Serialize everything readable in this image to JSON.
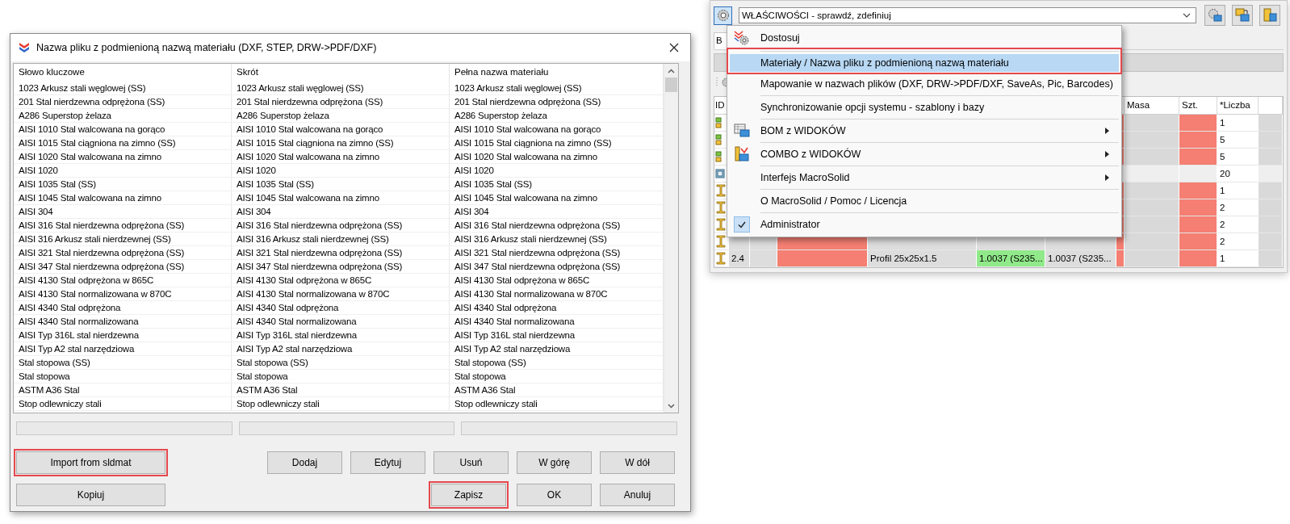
{
  "dialog": {
    "title": "Nazwa pliku z podmienioną nazwą materiału (DXF, STEP, DRW->PDF/DXF)",
    "table": {
      "columns": [
        "Słowo kluczowe",
        "Skrót",
        "Pełna nazwa materiału"
      ],
      "rows": [
        [
          "1023 Arkusz stali węglowej (SS)",
          "1023 Arkusz stali węglowej (SS)",
          "1023 Arkusz stali węglowej (SS)"
        ],
        [
          "201 Stal nierdzewna odprężona (SS)",
          "201 Stal nierdzewna odprężona (SS)",
          "201 Stal nierdzewna odprężona (SS)"
        ],
        [
          "A286 Superstop żelaza",
          "A286 Superstop żelaza",
          "A286 Superstop żelaza"
        ],
        [
          "AISI 1010 Stal walcowana na gorąco",
          "AISI 1010 Stal walcowana na gorąco",
          "AISI 1010 Stal walcowana na gorąco"
        ],
        [
          "AISI 1015 Stal ciągniona na zimno (SS)",
          "AISI 1015 Stal ciągniona na zimno (SS)",
          "AISI 1015 Stal ciągniona na zimno (SS)"
        ],
        [
          "AISI 1020 Stal walcowana na zimno",
          "AISI 1020 Stal walcowana na zimno",
          "AISI 1020 Stal walcowana na zimno"
        ],
        [
          "AISI 1020",
          "AISI 1020",
          "AISI 1020"
        ],
        [
          "AISI 1035 Stal (SS)",
          "AISI 1035 Stal (SS)",
          "AISI 1035 Stal (SS)"
        ],
        [
          "AISI 1045 Stal walcowana na zimno",
          "AISI 1045 Stal walcowana na zimno",
          "AISI 1045 Stal walcowana na zimno"
        ],
        [
          "AISI 304",
          "AISI 304",
          "AISI 304"
        ],
        [
          "AISI 316 Stal nierdzewna odprężona (SS)",
          "AISI 316 Stal nierdzewna odprężona (SS)",
          "AISI 316 Stal nierdzewna odprężona (SS)"
        ],
        [
          "AISI 316 Arkusz stali nierdzewnej (SS)",
          "AISI 316 Arkusz stali nierdzewnej (SS)",
          "AISI 316 Arkusz stali nierdzewnej (SS)"
        ],
        [
          "AISI 321 Stal nierdzewna odprężona (SS)",
          "AISI 321 Stal nierdzewna odprężona (SS)",
          "AISI 321 Stal nierdzewna odprężona (SS)"
        ],
        [
          "AISI 347 Stal nierdzewna odprężona (SS)",
          "AISI 347 Stal nierdzewna odprężona (SS)",
          "AISI 347 Stal nierdzewna odprężona (SS)"
        ],
        [
          "AISI 4130 Stal odprężona w 865C",
          "AISI 4130 Stal odprężona w 865C",
          "AISI 4130 Stal odprężona w 865C"
        ],
        [
          "AISI 4130 Stal normalizowana w 870C",
          "AISI 4130 Stal normalizowana w 870C",
          "AISI 4130 Stal normalizowana w 870C"
        ],
        [
          "AISI 4340 Stal odprężona",
          "AISI 4340 Stal odprężona",
          "AISI 4340 Stal odprężona"
        ],
        [
          "AISI 4340 Stal normalizowana",
          "AISI 4340 Stal normalizowana",
          "AISI 4340 Stal normalizowana"
        ],
        [
          "AISI Typ 316L stal nierdzewna",
          "AISI Typ 316L stal nierdzewna",
          "AISI Typ 316L stal nierdzewna"
        ],
        [
          "AISI Typ A2 stal narzędziowa",
          "AISI Typ A2 stal narzędziowa",
          "AISI Typ A2 stal narzędziowa"
        ],
        [
          "Stal stopowa (SS)",
          "Stal stopowa (SS)",
          "Stal stopowa (SS)"
        ],
        [
          "Stal stopowa",
          "Stal stopowa",
          "Stal stopowa"
        ],
        [
          "ASTM A36 Stal",
          "ASTM A36 Stal",
          "ASTM A36 Stal"
        ],
        [
          "Stop odlewniczy stali",
          "Stop odlewniczy stali",
          "Stop odlewniczy stali"
        ]
      ]
    },
    "fields": [
      {
        "disabled": true
      },
      {
        "disabled": true
      },
      {
        "disabled": true
      }
    ],
    "button_rows": [
      {
        "left": [
          {
            "label": "Import from sldmat",
            "highlighted": true
          }
        ],
        "right": [
          {
            "label": "Dodaj",
            "highlighted": false
          },
          {
            "label": "Edytuj",
            "highlighted": false
          },
          {
            "label": "Usuń",
            "highlighted": false
          },
          {
            "label": "W górę",
            "highlighted": false
          },
          {
            "label": "W dół",
            "highlighted": false
          }
        ]
      },
      {
        "left": [
          {
            "label": "Kopiuj",
            "highlighted": false
          }
        ],
        "right": [
          {
            "label": "Zapisz",
            "highlighted": true
          },
          {
            "label": "OK",
            "highlighted": false
          },
          {
            "label": "Anuluj",
            "highlighted": false
          }
        ]
      }
    ]
  },
  "panel": {
    "menu_button": {
      "open": true
    },
    "dropdown": {
      "value": "WŁAŚCIWOŚCI - sprawdź, zdefiniuj"
    },
    "tabs": [
      {
        "label": "B",
        "selected": true
      }
    ],
    "bom_table": {
      "header": {
        "id": "ID",
        "mass": "Masa",
        "qty": "Szt.",
        "count": "*Liczba"
      },
      "rows": [
        {
          "kind": "part",
          "count": "1"
        },
        {
          "kind": "part",
          "count": "5"
        },
        {
          "kind": "part",
          "count": "5"
        },
        {
          "kind": "group",
          "count": "20"
        },
        {
          "kind": "profile",
          "count": "1"
        },
        {
          "kind": "profile",
          "count": "2"
        },
        {
          "kind": "profile",
          "count": "2"
        },
        {
          "kind": "profile",
          "count": "2"
        },
        {
          "kind": "profile",
          "id": "2.4",
          "profile": "Profil 25x25x1.5",
          "material": "1.0037 (S235...",
          "material_2": "1.0037 (S235...",
          "count": "1"
        }
      ]
    },
    "menu": {
      "items": [
        {
          "label": "Dostosuj",
          "selected": false,
          "checked": false,
          "submenu": false,
          "separator_before": false,
          "highlighted": false
        },
        {
          "label": "Materiały / Nazwa pliku z podmienioną nazwą materiału",
          "selected": true,
          "checked": false,
          "submenu": false,
          "separator_before": true,
          "highlighted": true
        },
        {
          "label": "Mapowanie w nazwach plików (DXF, DRW->PDF/DXF, SaveAs, Pic, Barcodes)",
          "selected": false,
          "checked": false,
          "submenu": false,
          "separator_before": false,
          "highlighted": false
        },
        {
          "label": "Synchronizowanie opcji systemu - szablony i bazy",
          "selected": false,
          "checked": false,
          "submenu": false,
          "separator_before": true,
          "highlighted": false
        },
        {
          "label": "BOM z WIDOKÓW",
          "selected": false,
          "checked": false,
          "submenu": true,
          "separator_before": true,
          "highlighted": false
        },
        {
          "label": "COMBO z WIDOKÓW",
          "selected": false,
          "checked": false,
          "submenu": true,
          "separator_before": true,
          "highlighted": false
        },
        {
          "label": "Interfejs MacroSolid",
          "selected": false,
          "checked": false,
          "submenu": true,
          "separator_before": true,
          "highlighted": false
        },
        {
          "label": "O MacroSolid / Pomoc / Licencja",
          "selected": false,
          "checked": false,
          "submenu": false,
          "separator_before": true,
          "highlighted": false
        },
        {
          "label": "Administrator",
          "selected": false,
          "checked": true,
          "submenu": false,
          "separator_before": true,
          "highlighted": false
        }
      ]
    }
  }
}
